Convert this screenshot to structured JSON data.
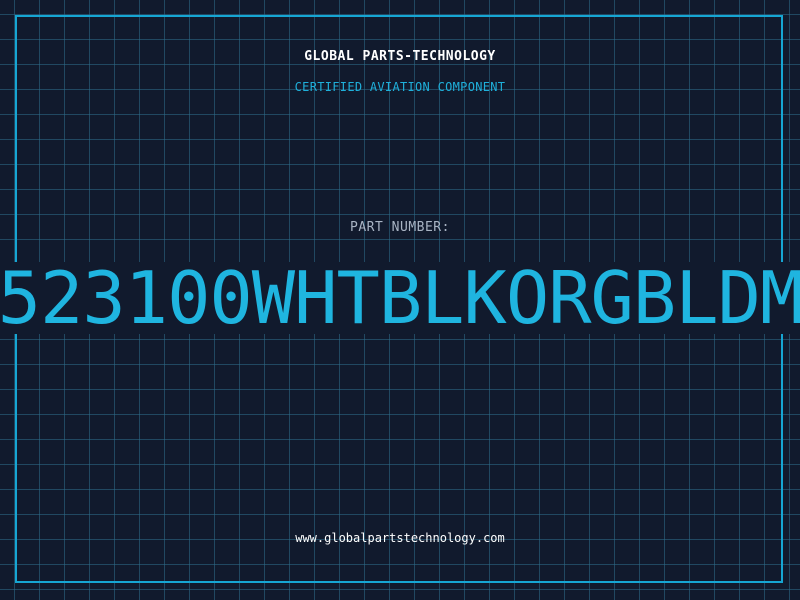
{
  "header": {
    "company": "GLOBAL PARTS-TECHNOLOGY",
    "subtitle": "CERTIFIED AVIATION COMPONENT"
  },
  "part": {
    "label": "PART NUMBER:",
    "number": "523100WHTBLKORGBLDM"
  },
  "footer": {
    "website": "www.globalpartstechnology.com"
  },
  "colors": {
    "background": "#111a2d",
    "accent": "#1fb5e0",
    "grid": "#2e6e8c",
    "label": "#a9b4c4",
    "text": "#ffffff"
  }
}
